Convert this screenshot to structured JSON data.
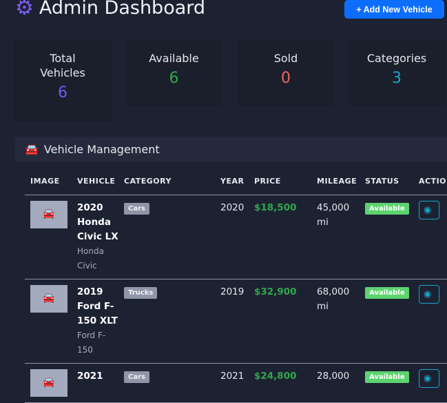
{
  "header": {
    "title": "Admin Dashboard",
    "add_button": "+ Add New Vehicle"
  },
  "stats": [
    {
      "label": "Total Vehicles",
      "value": "6",
      "color": "#6f5bf0"
    },
    {
      "label": "Available",
      "value": "6",
      "color": "#2fa84a"
    },
    {
      "label": "Sold",
      "value": "0",
      "color": "#ef6461"
    },
    {
      "label": "Categories",
      "value": "3",
      "color": "#1aa4c8"
    }
  ],
  "panel": {
    "title": "Vehicle Management"
  },
  "table": {
    "columns": [
      "IMAGE",
      "VEHICLE",
      "CATEGORY",
      "YEAR",
      "PRICE",
      "MILEAGE",
      "STATUS",
      "ACTIONS"
    ],
    "rows": [
      {
        "name": "2020 Honda Civic LX",
        "sub": "Honda Civic",
        "category": "Cars",
        "year": "2020",
        "price": "$18,500",
        "mileage": "45,000 mi",
        "status": "Available"
      },
      {
        "name": "2019 Ford F-150 XLT",
        "sub": "Ford F-150",
        "category": "Trucks",
        "year": "2019",
        "price": "$32,900",
        "mileage": "68,000 mi",
        "status": "Available"
      },
      {
        "name": "2021",
        "sub": "",
        "category": "Cars",
        "year": "2021",
        "price": "$24,800",
        "mileage": "28,000",
        "status": "Available"
      }
    ]
  }
}
